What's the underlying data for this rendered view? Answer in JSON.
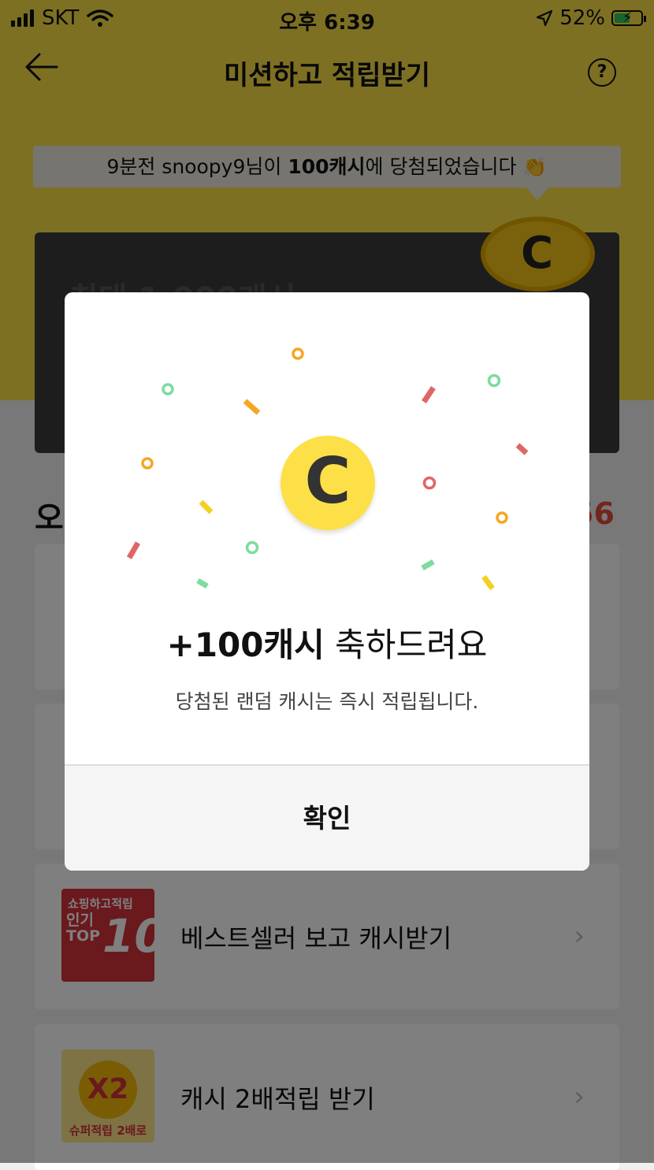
{
  "status_bar": {
    "carrier": "SKT",
    "time": "오후 6:39",
    "battery": "52%"
  },
  "nav": {
    "title": "미션하고 적립받기",
    "help": "?"
  },
  "ticker": {
    "prefix": "9분전 snoopy9님이 ",
    "highlight": "100캐시",
    "suffix": "에 당첨되었습니다 👏"
  },
  "banner": {
    "text": "최대 1,000캐시",
    "coin_letter": "C"
  },
  "section": {
    "title_partial": "오",
    "right_partial": "56"
  },
  "cards": [
    {
      "label": "베스트셀러 보고 캐시받기",
      "thumb_line1": "쇼핑하고적립",
      "thumb_line2": "인기\nTOP",
      "thumb_big": "10"
    },
    {
      "label": "캐시 2배적립 받기",
      "thumb_big": "X2",
      "thumb_sub": "슈퍼적립 2배로"
    }
  ],
  "modal": {
    "coin_letter": "C",
    "title_bold": "+100캐시",
    "title_rest": " 축하드려요",
    "subtitle": "당첨된 랜덤 캐시는 즉시 적립됩니다.",
    "confirm": "확인"
  },
  "colors": {
    "brand_yellow": "#fde047",
    "accent_red": "#e34b3a"
  }
}
